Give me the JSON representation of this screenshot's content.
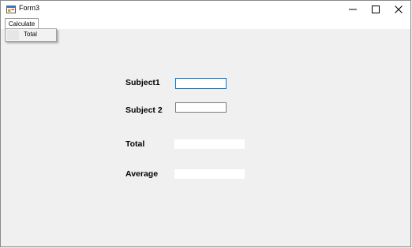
{
  "window": {
    "title": "Form3",
    "icons": {
      "app": "form-app-icon",
      "minimize": "minimize-icon",
      "maximize": "maximize-icon",
      "close": "close-icon"
    }
  },
  "menu": {
    "calculate_label": "Calculate",
    "dropdown_items": [
      {
        "label": "Total"
      }
    ]
  },
  "form": {
    "subject1": {
      "label": "Subject1",
      "value": ""
    },
    "subject2": {
      "label": "Subject 2",
      "value": ""
    },
    "total": {
      "label": "Total",
      "value": ""
    },
    "average": {
      "label": "Average",
      "value": ""
    }
  },
  "colors": {
    "focus_border": "#0078d7",
    "window_background": "#f0f0f0"
  }
}
